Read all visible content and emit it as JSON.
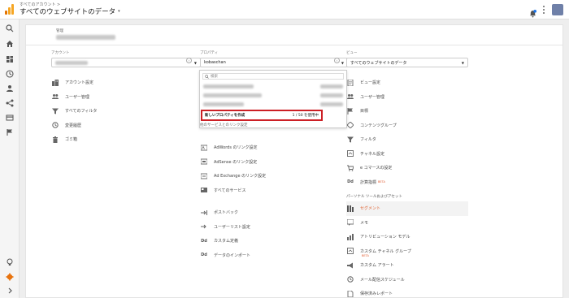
{
  "header": {
    "crumb": "すべてのアカウント >",
    "title": "すべてのウェブサイトのデータ",
    "caret": "▾",
    "colors": {
      "logo_orange": "#f6a623",
      "logo_darkorange": "#e37400"
    }
  },
  "rail": {
    "icons": [
      "search-icon",
      "home-icon",
      "dashboard-icon",
      "clock-icon",
      "person-icon",
      "flow-icon",
      "card-icon",
      "flag-icon",
      "bulb-icon",
      "gear-icon",
      "chevron-right-icon"
    ],
    "active_color": "#e8710a"
  },
  "admin": {
    "label": "管理"
  },
  "account": {
    "label": "アカウント",
    "select_value": "",
    "items": [
      {
        "icon": "building-icon",
        "label": "アカウント設定"
      },
      {
        "icon": "users-icon",
        "label": "ユーザー管理"
      },
      {
        "icon": "filter-icon",
        "label": "すべてのフィルタ"
      },
      {
        "icon": "history-icon",
        "label": "変更履歴"
      },
      {
        "icon": "trash-icon",
        "label": "ゴミ箱"
      }
    ]
  },
  "property": {
    "label": "プロパティ",
    "select_value": "kobaschan",
    "search_placeholder": "検索",
    "create_label": "新しいプロパティを作成",
    "usage": "1 / 50 を使用中",
    "links_header": "他のサービスとのリンク設定",
    "items": [
      {
        "icon": "adwords-icon",
        "label": "AdWords のリンク設定"
      },
      {
        "icon": "adsense-icon",
        "label": "AdSense のリンク設定"
      },
      {
        "icon": "adexchange-icon",
        "label": "Ad Exchange のリンク設定"
      },
      {
        "icon": "services-icon",
        "label": "すべてのサービス"
      },
      {
        "icon": "postback-icon",
        "label": "ポストバック"
      },
      {
        "icon": "userlist-icon",
        "label": "ユーザーリスト設定"
      },
      {
        "icon": "dd-icon",
        "label": "カスタム定義"
      },
      {
        "icon": "dd-icon",
        "label": "データのインポート"
      }
    ]
  },
  "view": {
    "label": "ビュー",
    "select_value": "すべてのウェブサイトのデータ",
    "items": [
      {
        "icon": "doc-icon",
        "label": "ビュー設定"
      },
      {
        "icon": "users-icon",
        "label": "ユーザー管理"
      },
      {
        "icon": "flag-icon",
        "label": "目標"
      },
      {
        "icon": "grouping-icon",
        "label": "コンテンツグループ"
      },
      {
        "icon": "filter-icon",
        "label": "フィルタ"
      },
      {
        "icon": "channel-icon",
        "label": "チャネル設定"
      },
      {
        "icon": "cart-icon",
        "label": "e コマースの設定"
      },
      {
        "icon": "dd-icon",
        "label": "計算指標",
        "beta": "BETA"
      }
    ],
    "personal_header": "パーソナル ツールおよびアセット",
    "personal_items": [
      {
        "icon": "segment-icon",
        "label": "セグメント",
        "active": true
      },
      {
        "icon": "note-icon",
        "label": "メモ"
      },
      {
        "icon": "attribution-icon",
        "label": "アトリビューション モデル"
      },
      {
        "icon": "channel-icon",
        "label": "カスタム チャネル グループ",
        "beta": "BETA"
      },
      {
        "icon": "megaphone-icon",
        "label": "カスタム アラート"
      },
      {
        "icon": "clock-icon",
        "label": "メール配信スケジュール"
      },
      {
        "icon": "report-icon",
        "label": "保存済みレポート"
      }
    ]
  }
}
